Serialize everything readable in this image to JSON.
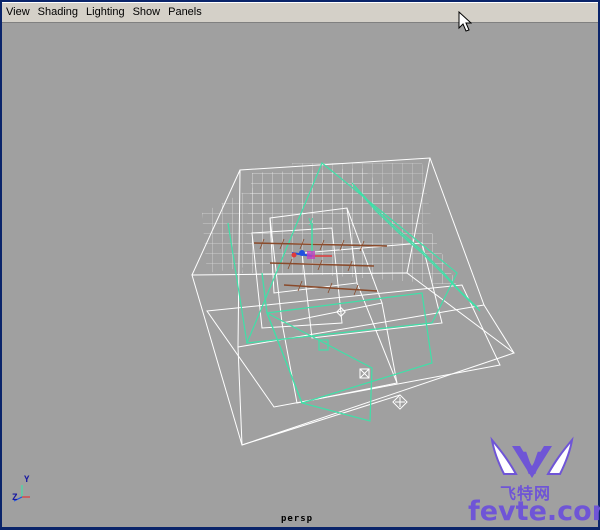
{
  "menubar": {
    "items": [
      {
        "id": "view",
        "label": "View"
      },
      {
        "id": "shading",
        "label": "Shading"
      },
      {
        "id": "lighting",
        "label": "Lighting"
      },
      {
        "id": "show",
        "label": "Show"
      },
      {
        "id": "panels",
        "label": "Panels"
      }
    ]
  },
  "viewport": {
    "camera_label": "persp",
    "axis_indicator": {
      "y": "Y",
      "z": "Z"
    }
  },
  "watermark": {
    "logo_letter": "V",
    "chinese_text": "飞特网",
    "site_text": "fevte.com"
  },
  "colors": {
    "viewport_bg": "#a0a0a0",
    "wire_white": "#ffffff",
    "wire_selected": "#3fe0a8",
    "light_brown": "#8a4a2a",
    "menubar_bg": "#d4d0c8",
    "watermark": "#6f55d6"
  },
  "icons": [
    "mouse-cursor-icon",
    "axis-indicator-icon",
    "manipulator-icon"
  ]
}
